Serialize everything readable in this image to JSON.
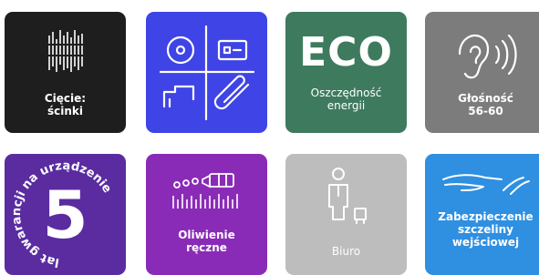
{
  "tiles": [
    {
      "id": "cutting",
      "lines": [
        "Cięcie:",
        "ścinki"
      ],
      "bg": "#1e1e1e",
      "icon": "shred-strips-icon"
    },
    {
      "id": "office",
      "lines": [],
      "bg": "#3f44e6",
      "icon": "office-supplies-icon"
    },
    {
      "id": "eco",
      "badge": "ECO",
      "lines": [
        "Oszczędność",
        "energii"
      ],
      "bg": "#3e7a5e",
      "icon": "eco-text"
    },
    {
      "id": "noise",
      "lines": [
        "Głośność",
        "56-60"
      ],
      "bg": "#7c7c7c",
      "icon": "ear-sound-icon"
    },
    {
      "id": "warranty",
      "number": "5",
      "ring_text": "lat gwarancji na urządzenie",
      "lines": [],
      "bg": "#5a2ca0",
      "icon": "warranty-seal-icon"
    },
    {
      "id": "oiling",
      "lines": [
        "Oliwienie",
        "ręczne"
      ],
      "bg": "#8a2bb8",
      "icon": "oil-drops-icon"
    },
    {
      "id": "usage",
      "lines": [
        "Biuro"
      ],
      "bg": "#bdbdbd",
      "icon": "office-worker-icon"
    },
    {
      "id": "safety",
      "lines": [
        "Zabezpieczenie",
        "szczeliny",
        "wejściowej"
      ],
      "bg": "#2f8fe0",
      "icon": "hand-slot-protection-icon"
    }
  ]
}
